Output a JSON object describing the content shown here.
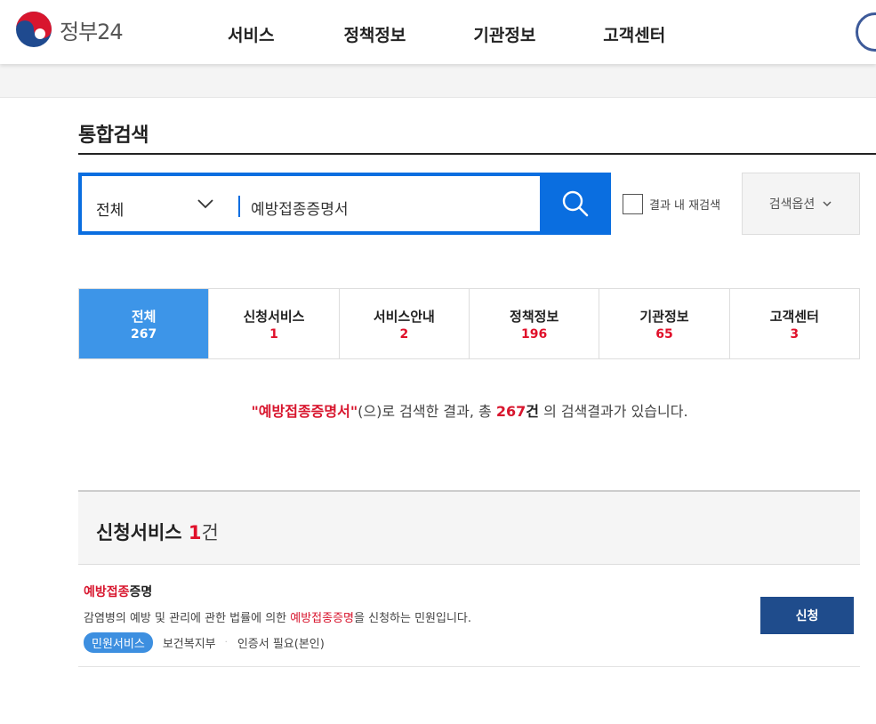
{
  "header": {
    "logo_text": "정부24",
    "nav": [
      "서비스",
      "정책정보",
      "기관정보",
      "고객센터"
    ]
  },
  "search": {
    "page_title": "통합검색",
    "category": "전체",
    "query": "예방접종증명서",
    "re_search_label": "결과 내 재검색",
    "options_label": "검색옵션"
  },
  "tabs": [
    {
      "label": "전체",
      "count": "267",
      "active": true
    },
    {
      "label": "신청서비스",
      "count": "1",
      "active": false
    },
    {
      "label": "서비스안내",
      "count": "2",
      "active": false
    },
    {
      "label": "정책정보",
      "count": "196",
      "active": false
    },
    {
      "label": "기관정보",
      "count": "65",
      "active": false
    },
    {
      "label": "고객센터",
      "count": "3",
      "active": false
    }
  ],
  "summary": {
    "keyword": "\"예방접종증명서\"",
    "text1": "(으)로 검색한 결과, 총 ",
    "total": "267",
    "unit": "건",
    "text2": " 의 검색결과가 있습니다."
  },
  "section": {
    "title": "신청서비스 ",
    "count": "1",
    "unit": "건"
  },
  "result": {
    "title_hl": "예방접종",
    "title_rest": "증명",
    "desc_before": "감염병의 예방 및 관리에 관한 법률에 의한 ",
    "desc_hl": "예방접종증명",
    "desc_after": "을 신청하는 민원입니다.",
    "badge": "민원서비스",
    "agency": "보건복지부",
    "cert": "인증서 필요(본인)",
    "apply_label": "신청"
  },
  "colors": {
    "primary": "#0a6ee0",
    "tab_active": "#3d95e8",
    "highlight": "#d8162e",
    "apply_button": "#1f4c8c"
  }
}
